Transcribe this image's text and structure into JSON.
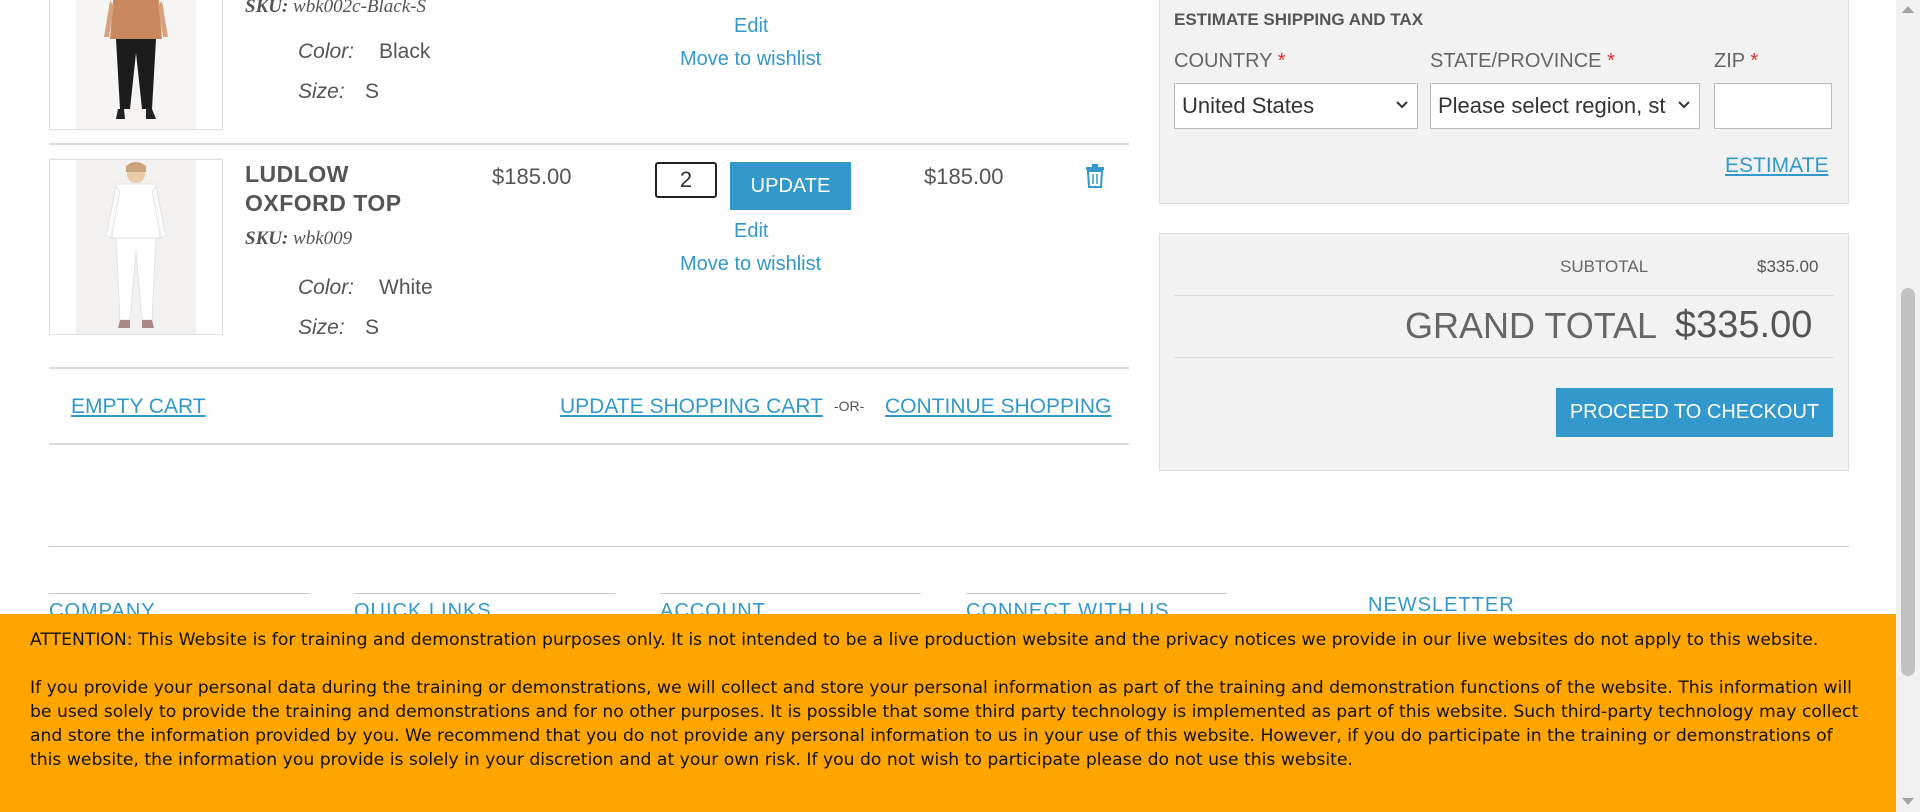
{
  "cart": {
    "items": [
      {
        "name_lines": [],
        "sku_label": "SKU:",
        "sku": "wbk002c-Black-S",
        "color_label": "Color:",
        "color": "Black",
        "size_label": "Size:",
        "size": "S",
        "edit": "Edit",
        "wishlist": "Move to wishlist",
        "image": "orange-top-black-pants-model"
      },
      {
        "name_lines": [
          "LUDLOW",
          "OXFORD TOP"
        ],
        "sku_label": "SKU:",
        "sku": "wbk009",
        "price": "$185.00",
        "qty": "2",
        "update_label": "UPDATE",
        "subtotal": "$185.00",
        "color_label": "Color:",
        "color": "White",
        "size_label": "Size:",
        "size": "S",
        "edit": "Edit",
        "wishlist": "Move to wishlist",
        "delete_icon": "trash-icon",
        "image": "white-shirt-white-pants-model"
      }
    ],
    "actions": {
      "empty_cart": "EMPTY CART",
      "update_cart": "UPDATE SHOPPING CART",
      "or": "-OR-",
      "continue": "CONTINUE SHOPPING"
    }
  },
  "estimate": {
    "title": "ESTIMATE SHIPPING AND TAX",
    "country_label": "COUNTRY",
    "state_label": "STATE/PROVINCE",
    "zip_label": "ZIP",
    "required_mark": "*",
    "country_value": "United States",
    "state_value": "Please select region, st",
    "zip_value": "",
    "estimate_button": "ESTIMATE"
  },
  "totals": {
    "subtotal_label": "SUBTOTAL",
    "subtotal_value": "$335.00",
    "grand_label": "GRAND TOTAL",
    "grand_value": "$335.00",
    "checkout_button": "PROCEED TO CHECKOUT"
  },
  "footer": {
    "headings": [
      "COMPANY",
      "QUICK LINKS",
      "ACCOUNT",
      "CONNECT WITH US",
      "NEWSLETTER"
    ]
  },
  "notice": {
    "paragraph1": "ATTENTION: This Website is for training and demonstration purposes only. It is not intended to be a live production website and the privacy notices we provide in our live websites do not apply to this website.",
    "paragraph2": "If you provide your personal data during the training or demonstrations, we will collect and store your personal information as part of the training and demonstration functions of the website. This information will be used solely to provide the training and demonstrations and for no other purposes. It is possible that some third party technology is implemented as part of this website. Such third-party technology may collect and store the information provided by you. We recommend that you do not provide any personal information to us in your use of this website. However, if you do participate in the training or demonstrations of this website, the information you provide is solely in your discretion and at your own risk. If you do not wish to participate please do not use this website."
  },
  "colors": {
    "accent": "#3399cc",
    "notice_bg": "#ffa500",
    "required": "#e02b27"
  }
}
